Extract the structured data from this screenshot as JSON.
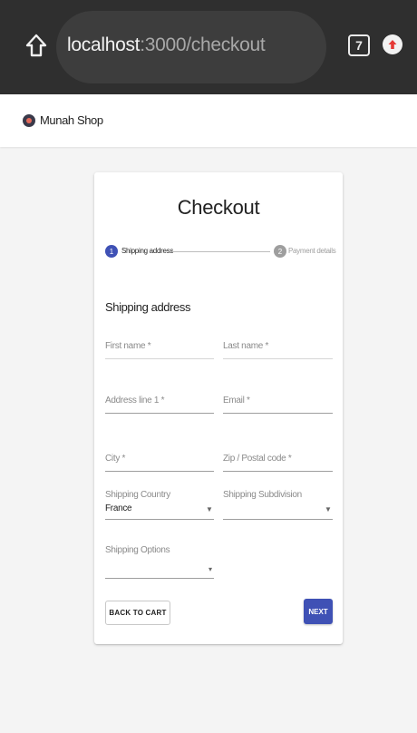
{
  "browser": {
    "url_host": "localhost",
    "url_path": ":3000/checkout",
    "tab_count": "7"
  },
  "app": {
    "shop_name": "Munah Shop"
  },
  "checkout": {
    "title": "Checkout",
    "steps": [
      {
        "number": "1",
        "label": "Shipping address"
      },
      {
        "number": "2",
        "label": "Payment details"
      }
    ],
    "section_title": "Shipping address",
    "fields": {
      "first_name": "First name *",
      "last_name": "Last name *",
      "address_line1": "Address line 1 *",
      "email": "Email *",
      "city": "City *",
      "zip": "Zip / Postal code *",
      "shipping_country_label": "Shipping Country",
      "shipping_country_value": "France",
      "shipping_subdivision_label": "Shipping Subdivision",
      "shipping_options_label": "Shipping Options"
    },
    "buttons": {
      "back": "BACK TO CART",
      "next": "NEXT"
    }
  },
  "colors": {
    "primary": "#3f51b5",
    "browser_bar": "#2f2f2f"
  }
}
